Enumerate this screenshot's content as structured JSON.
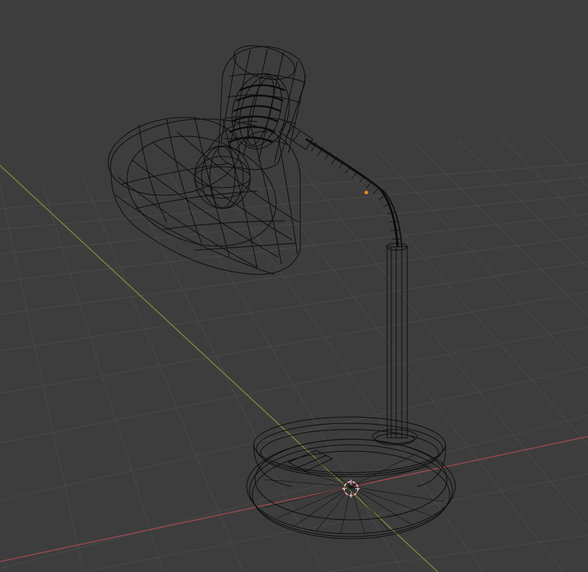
{
  "viewport": {
    "shading": "wireframe",
    "background_color": "#3d3d3d",
    "grid_color": "#4a4a4a",
    "wire_color": "#0b0b0b",
    "axis_x_color": "#9b4a4f",
    "axis_y_color": "#6e8f3a",
    "selection_color": "#ff8a1a",
    "cursor_color": "#e8e8e8",
    "cursor_accent_color": "#e04848"
  },
  "scene": {
    "object": "desk-lamp"
  }
}
